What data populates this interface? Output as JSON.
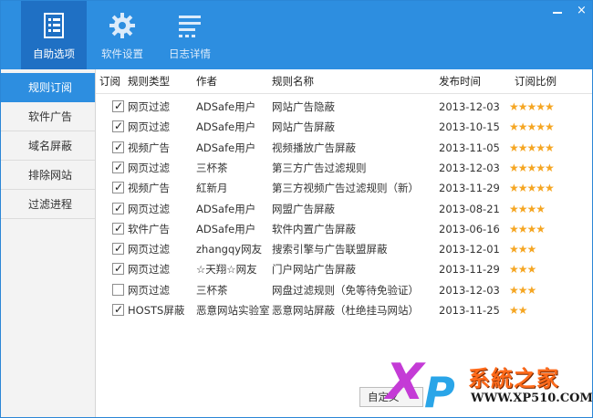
{
  "window_controls": {
    "minimize": "—",
    "close": "×"
  },
  "toolbar": [
    {
      "label": "自助选项",
      "icon": "checklist-icon",
      "active": true
    },
    {
      "label": "软件设置",
      "icon": "gear-icon",
      "active": false
    },
    {
      "label": "日志详情",
      "icon": "list-lines-icon",
      "active": false
    }
  ],
  "sidebar": {
    "items": [
      {
        "label": "规则订阅",
        "active": true
      },
      {
        "label": "软件广告",
        "active": false
      },
      {
        "label": "域名屏蔽",
        "active": false
      },
      {
        "label": "排除网站",
        "active": false
      },
      {
        "label": "过滤进程",
        "active": false
      }
    ]
  },
  "table": {
    "headers": {
      "subscribe": "订阅",
      "type": "规则类型",
      "author": "作者",
      "name": "规则名称",
      "date": "发布时间",
      "ratio": "订阅比例"
    },
    "rows": [
      {
        "checked": true,
        "type": "网页过滤",
        "author": "ADSafe用户",
        "name": "网站广告隐蔽",
        "date": "2013-12-03",
        "stars": 5
      },
      {
        "checked": true,
        "type": "网页过滤",
        "author": "ADSafe用户",
        "name": "网站广告屏蔽",
        "date": "2013-10-15",
        "stars": 5
      },
      {
        "checked": true,
        "type": "视频广告",
        "author": "ADSafe用户",
        "name": "视频播放广告屏蔽",
        "date": "2013-11-05",
        "stars": 5
      },
      {
        "checked": true,
        "type": "网页过滤",
        "author": "三杯茶",
        "name": "第三方广告过滤规则",
        "date": "2013-12-03",
        "stars": 5
      },
      {
        "checked": true,
        "type": "视频广告",
        "author": "紅新月",
        "name": "第三方视频广告过滤规则（新）",
        "date": "2013-11-29",
        "stars": 5
      },
      {
        "checked": true,
        "type": "网页过滤",
        "author": "ADSafe用户",
        "name": "网盟广告屏蔽",
        "date": "2013-08-21",
        "stars": 4
      },
      {
        "checked": true,
        "type": "软件广告",
        "author": "ADSafe用户",
        "name": "软件内置广告屏蔽",
        "date": "2013-06-16",
        "stars": 4
      },
      {
        "checked": true,
        "type": "网页过滤",
        "author": "zhangqy网友",
        "name": "搜索引擎与广告联盟屏蔽",
        "date": "2013-12-01",
        "stars": 3
      },
      {
        "checked": true,
        "type": "网页过滤",
        "author": "☆天翔☆网友",
        "name": "门户网站广告屏蔽",
        "date": "2013-11-29",
        "stars": 3
      },
      {
        "checked": false,
        "type": "网页过滤",
        "author": "三杯茶",
        "name": "网盘过滤规则（免等待免验证）",
        "date": "2013-12-03",
        "stars": 3
      },
      {
        "checked": true,
        "type": "HOSTS屏蔽",
        "author": "恶意网站实验室",
        "name": "恶意网站屏蔽（杜绝挂马网站）",
        "date": "2013-11-25",
        "stars": 2
      }
    ]
  },
  "footer": {
    "custom_button": "自定义"
  },
  "watermark": {
    "logo_x": "X",
    "logo_p": "P",
    "brand": "系統之家",
    "url": "WWW.XP510.COM"
  },
  "colors": {
    "accent": "#2d8ee0",
    "accent_dark": "#1f70c4",
    "star": "#f5a623"
  }
}
